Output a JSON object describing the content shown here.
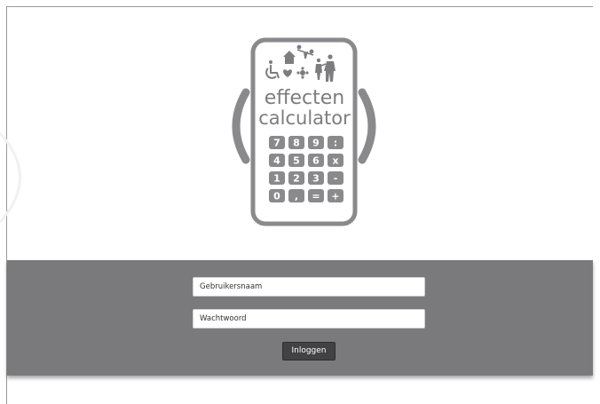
{
  "logo": {
    "line1": "effecten",
    "line2": "calculator",
    "keys": [
      "7",
      "8",
      "9",
      ":",
      "4",
      "5",
      "6",
      "x",
      "1",
      "2",
      "3",
      "-",
      "0",
      ",",
      "=",
      "+"
    ],
    "icons": [
      "wheelchair-icon",
      "house-icon",
      "seesaw-icon",
      "heart-icon",
      "flower-icon",
      "family-icon"
    ]
  },
  "login": {
    "username_placeholder": "Gebruikersnaam",
    "password_placeholder": "Wachtwoord",
    "submit_label": "Inloggen"
  },
  "colors": {
    "logo_gray": "#8a8a8d",
    "band": "#7a7a7d",
    "button": "#424244"
  }
}
